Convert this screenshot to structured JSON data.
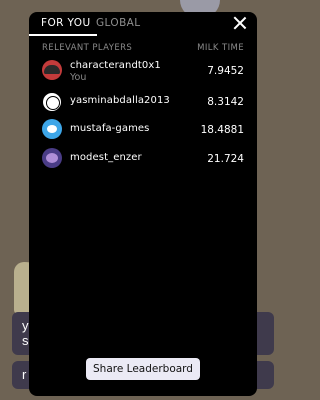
{
  "background": {
    "card_top_text": "y\ns",
    "card_bottom_text": "r"
  },
  "leaderboard": {
    "tabs": [
      {
        "label": "FOR YOU",
        "active": true
      },
      {
        "label": "GLOBAL",
        "active": false
      }
    ],
    "column_headers": {
      "left": "RELEVANT PLAYERS",
      "right": "MILK TIME"
    },
    "players": [
      {
        "name": "characterandt0x1",
        "subtitle": "You",
        "score": "7.9452",
        "avatar_icon": "red-character-avatar"
      },
      {
        "name": "yasminabdalla2013",
        "subtitle": "",
        "score": "8.3142",
        "avatar_icon": "outline-face-avatar"
      },
      {
        "name": "mustafa-games",
        "subtitle": "",
        "score": "18.4881",
        "avatar_icon": "blue-cloud-avatar"
      },
      {
        "name": "modest_enzer",
        "subtitle": "",
        "score": "21.724",
        "avatar_icon": "purple-character-avatar"
      }
    ],
    "share_label": "Share Leaderboard"
  },
  "colors": {
    "panel_bg": "#000000",
    "page_bg": "#6e6354",
    "active_tab": "#ffffff",
    "inactive_tab": "#8f8f8f",
    "button_bg": "#ebeaf5"
  }
}
